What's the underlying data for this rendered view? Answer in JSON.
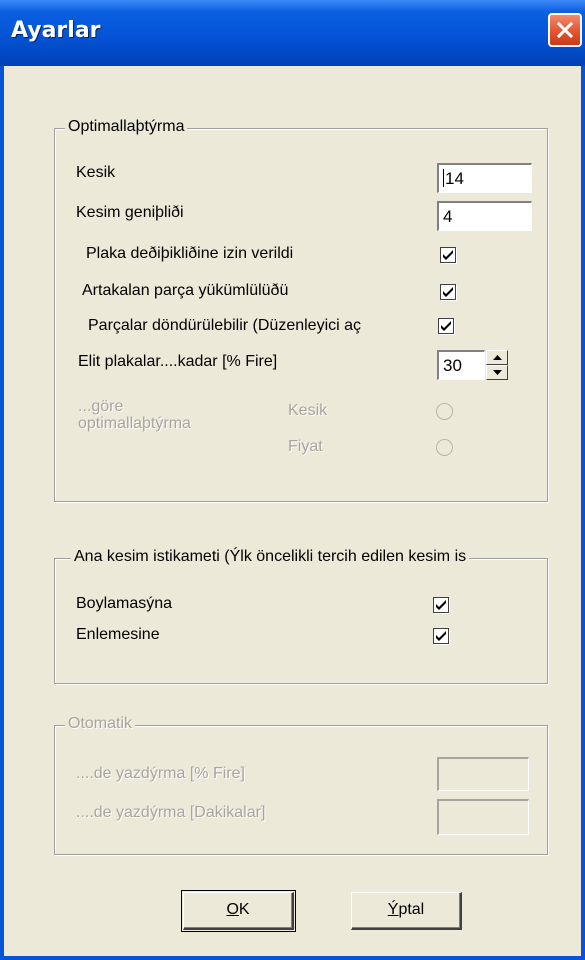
{
  "window": {
    "title": "Ayarlar"
  },
  "optimization": {
    "legend": "Optimallaþtýrma",
    "kesik_label": "Kesik",
    "kesik_value": "14",
    "kesim_genisligi_label": "Kesim geniþliði",
    "kesim_genisligi_value": "4",
    "plaka_label": "Plaka deðiþikliðine izin verildi",
    "plaka_checked": true,
    "artakalan_label": "Artakalan parça yükümlülüðü",
    "artakalan_checked": true,
    "parcalar_label": "Parçalar döndürülebilir (Düzenleyici aç",
    "parcalar_checked": true,
    "elit_label": "Elit plakalar....kadar [% Fire]",
    "elit_value": "30",
    "gore_line1": "...göre",
    "gore_line2": "optimallaþtýrma",
    "radio_kesik": "Kesik",
    "radio_fiyat": "Fiyat"
  },
  "direction": {
    "legend": "Ana kesim istikameti (Ýlk öncelikli tercih edilen kesim is",
    "boylamasina_label": "Boylamasýna",
    "boylamasina_checked": true,
    "enlemesine_label": "Enlemesine",
    "enlemesine_checked": true
  },
  "automatic": {
    "legend": "Otomatik",
    "fire_label": "....de yazdýrma [% Fire]",
    "fire_value": "",
    "dakika_label": "....de yazdýrma [Dakikalar]",
    "dakika_value": ""
  },
  "buttons": {
    "ok_mnemonic": "O",
    "ok_rest": "K",
    "iptal_mnemonic": "Ý",
    "iptal_rest": "ptal"
  }
}
